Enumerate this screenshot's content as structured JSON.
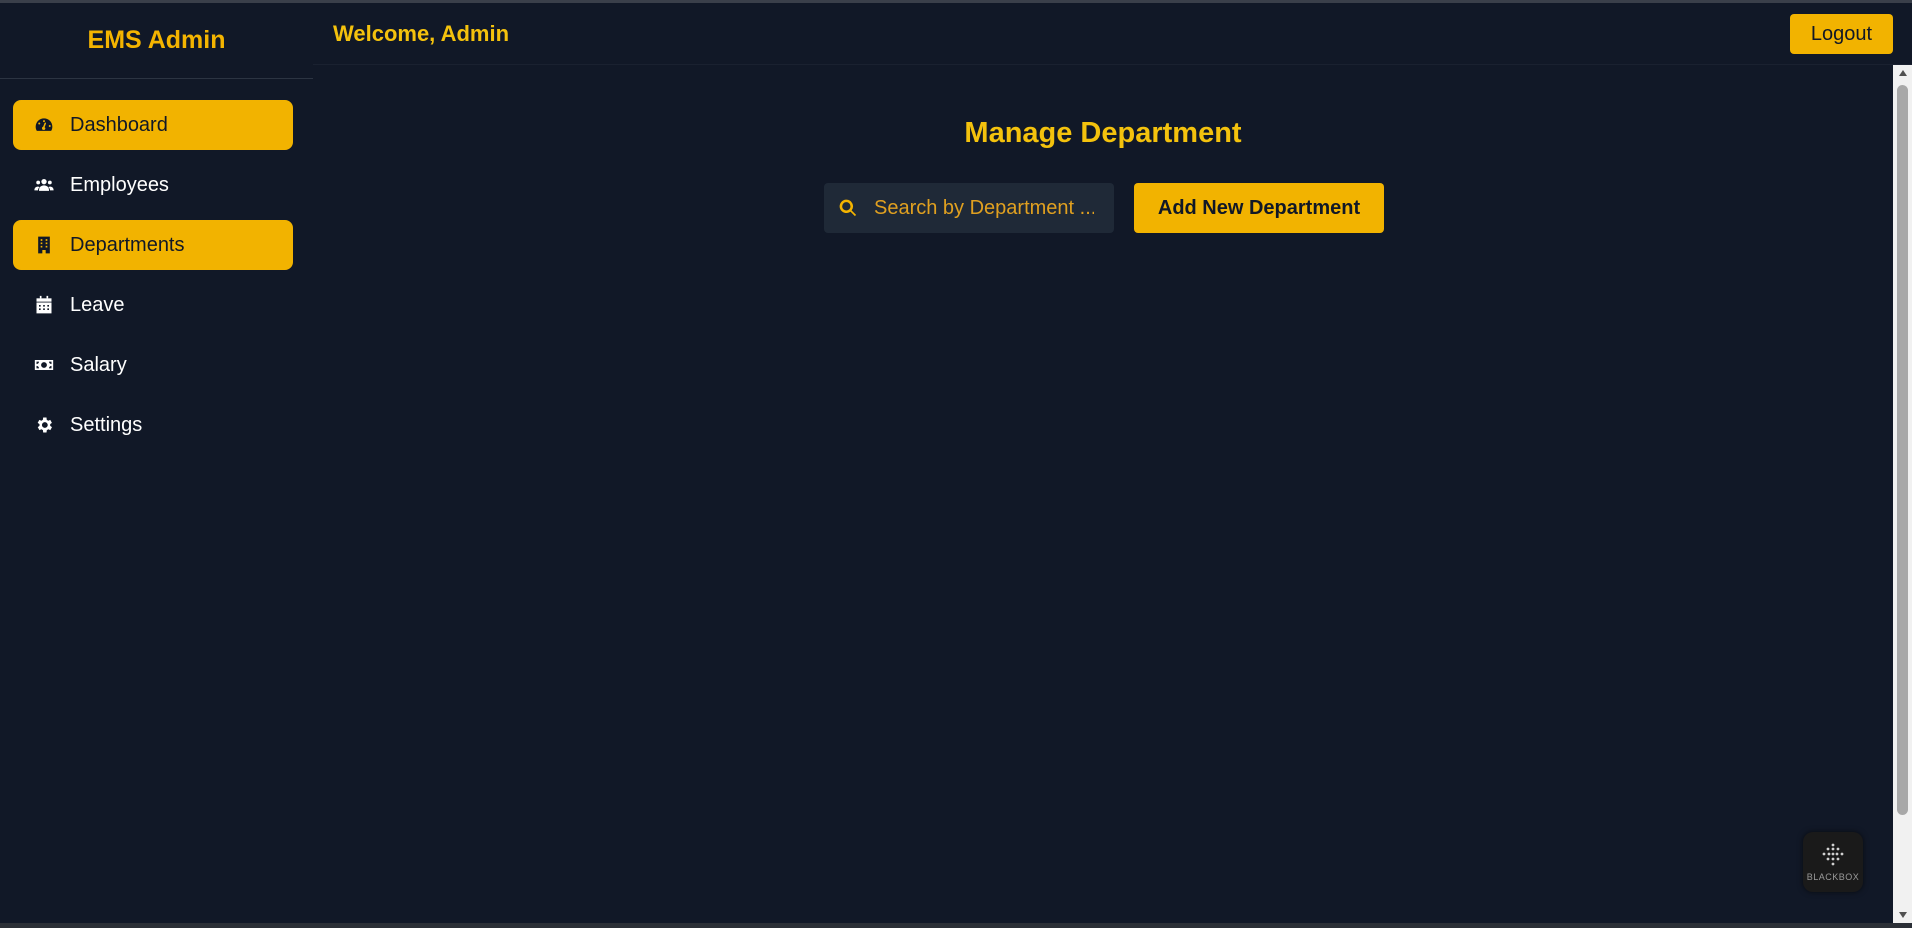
{
  "brand": {
    "title": "EMS Admin"
  },
  "sidebar": {
    "items": [
      {
        "label": "Dashboard",
        "icon": "dashboard-gauge-icon",
        "active": true
      },
      {
        "label": "Employees",
        "icon": "users-icon",
        "active": false
      },
      {
        "label": "Departments",
        "icon": "building-icon",
        "active": true
      },
      {
        "label": "Leave",
        "icon": "calendar-icon",
        "active": false
      },
      {
        "label": "Salary",
        "icon": "money-bill-icon",
        "active": false
      },
      {
        "label": "Settings",
        "icon": "gear-icon",
        "active": false
      }
    ]
  },
  "header": {
    "welcome": "Welcome, Admin",
    "logout_label": "Logout"
  },
  "main": {
    "title": "Manage Department",
    "search": {
      "placeholder": "Search by Department ...",
      "value": ""
    },
    "add_label": "Add New Department"
  },
  "widget": {
    "label": "BLACKBOX"
  },
  "colors": {
    "accent": "#f2b300",
    "background": "#111827",
    "input_bg": "#1f2937"
  }
}
